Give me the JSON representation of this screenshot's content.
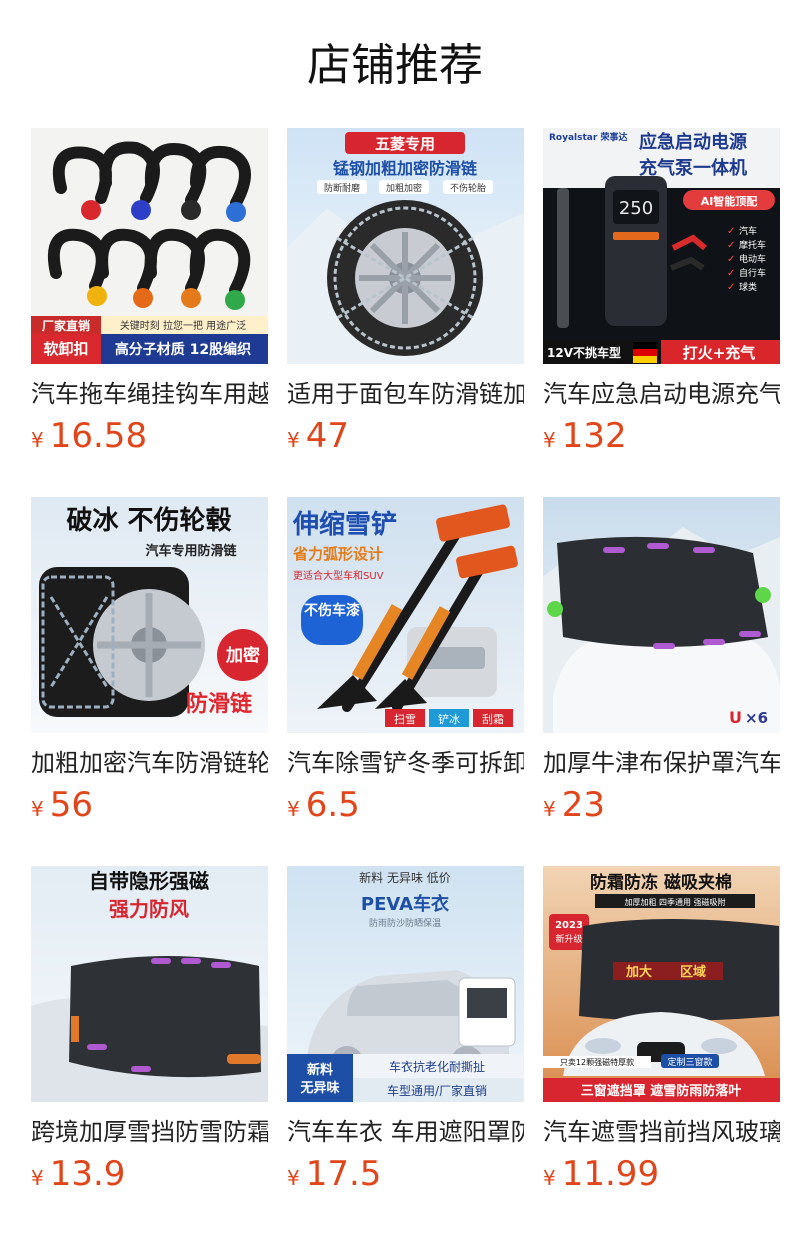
{
  "page": {
    "title": "店铺推荐"
  },
  "colors": {
    "price": "#e1451a",
    "title_text": "#222222"
  },
  "currency_symbol": "¥",
  "products": [
    {
      "title": "汽车拖车绳挂钩车用越野",
      "price": "16.58",
      "image_text": [
        "厂家直销",
        "关键时刻 拉您一把 用途广泛",
        "软卸扣",
        "高分子材质 12股编织"
      ]
    },
    {
      "title": "适用于面包车防滑链加粗",
      "price": "47",
      "image_text": [
        "五菱专用",
        "锰钢加粗加密防滑链",
        "防断耐磨",
        "加粗加密",
        "不伤轮胎"
      ]
    },
    {
      "title": "汽车应急启动电源充气泵",
      "price": "132",
      "image_text": [
        "Royalstar 荣事达",
        "应急启动电源",
        "充气泵一体机",
        "AI智能顶配",
        "汽车",
        "摩托车",
        "电动车",
        "自行车",
        "球类",
        "250",
        "12V不挑车型",
        "打火+充气"
      ]
    },
    {
      "title": "加粗加密汽车防滑链轮胎",
      "price": "56",
      "image_text": [
        "破冰 不伤轮毂",
        "汽车专用防滑链",
        "加密",
        "防滑链"
      ]
    },
    {
      "title": "汽车除雪铲冬季可拆卸伸",
      "price": "6.5",
      "image_text": [
        "伸缩雪铲",
        "省力弧形设计",
        "更适合大型车和SUV",
        "不伤车漆",
        "扫雪",
        "铲冰",
        "刮霜"
      ]
    },
    {
      "title": "加厚牛津布保护罩汽车前",
      "price": "23",
      "image_text": [
        "×6"
      ]
    },
    {
      "title": "跨境加厚雪挡防雪防霜汽",
      "price": "13.9",
      "image_text": [
        "自带隐形强磁",
        "强力防风"
      ]
    },
    {
      "title": "汽车车衣 车用遮阳罩防",
      "price": "17.5",
      "image_text": [
        "新料 无异味 低价",
        "PEVA车衣",
        "防雨防沙防晒保温",
        "新料",
        "无异味",
        "车衣抗老化耐撕扯",
        "车型通用/厂家直销"
      ]
    },
    {
      "title": "汽车遮雪挡前挡风玻璃防",
      "price": "11.99",
      "image_text": [
        "防霜防冻 磁吸夹棉",
        "加厚加粗 四季通用 强磁吸附",
        "2023",
        "新升级",
        "加大",
        "区域",
        "只卖12颗强磁特厚款",
        "定制三窗款",
        "三窗遮挡罩 遮雪防雨防落叶"
      ]
    }
  ]
}
